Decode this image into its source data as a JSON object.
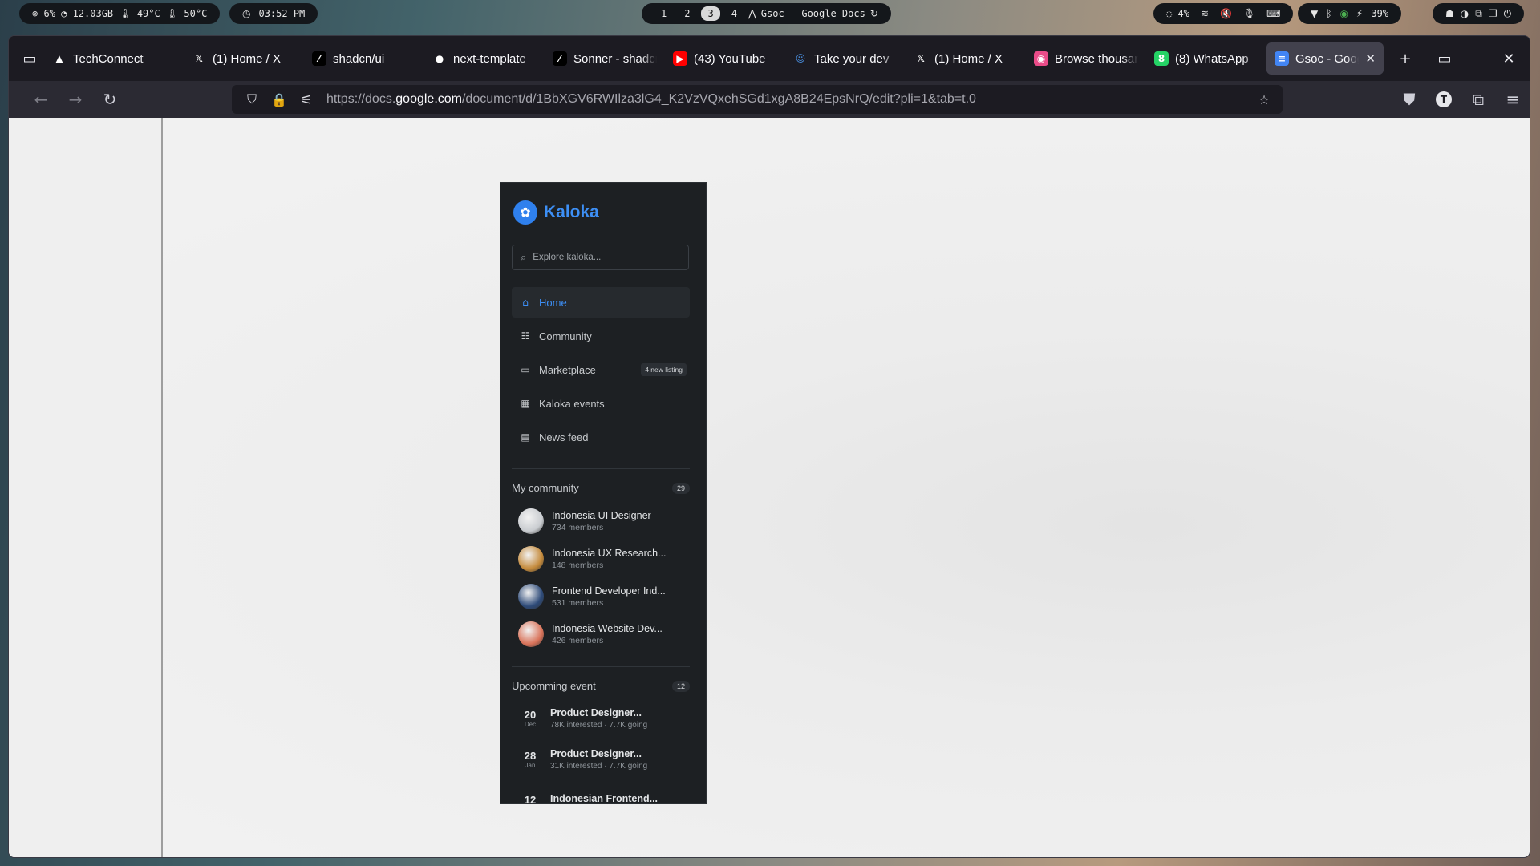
{
  "sysbar": {
    "stats": "⊚ 6%  ◔ 12.03GB  🌡 49°C  🌡 50°C",
    "clock": "03:52 PM",
    "workspaces": [
      "1",
      "2",
      "3",
      "4"
    ],
    "active_workspace": "3",
    "window_title": "Gsoc - Google Docs",
    "status_left": "◌ 4%",
    "battery": "39%"
  },
  "browser": {
    "tabs": [
      {
        "label": "TechConnect",
        "icon": "techconnect-icon",
        "fav": "▲",
        "fav_bg": "#1c1b22",
        "fav_fg": "#ffffff"
      },
      {
        "label": "(1) Home / X",
        "icon": "x-icon",
        "fav": "𝕏",
        "fav_bg": "#1c1b22",
        "fav_fg": "#ffffff"
      },
      {
        "label": "shadcn/ui",
        "icon": "shadcn-icon",
        "fav": "⁄",
        "fav_bg": "#000000",
        "fav_fg": "#ffffff"
      },
      {
        "label": "next-template",
        "icon": "github-icon",
        "fav": "●",
        "fav_bg": "#1c1b22",
        "fav_fg": "#ffffff"
      },
      {
        "label": "Sonner - shadcn",
        "icon": "shadcn-icon",
        "fav": "⁄",
        "fav_bg": "#000000",
        "fav_fg": "#ffffff"
      },
      {
        "label": "(43) YouTube",
        "icon": "youtube-icon",
        "fav": "▶",
        "fav_bg": "#ff0000",
        "fav_fg": "#ffffff"
      },
      {
        "label": "Take your dev",
        "icon": "devpost-icon",
        "fav": "☺",
        "fav_bg": "#1c1b22",
        "fav_fg": "#4a90e2"
      },
      {
        "label": "(1) Home / X",
        "icon": "x-icon",
        "fav": "𝕏",
        "fav_bg": "#1c1b22",
        "fav_fg": "#ffffff"
      },
      {
        "label": "Browse thousands",
        "icon": "dribbble-icon",
        "fav": "◉",
        "fav_bg": "#ea4c89",
        "fav_fg": "#ffffff"
      },
      {
        "label": "(8) WhatsApp",
        "icon": "whatsapp-icon",
        "fav": "8",
        "fav_bg": "#25d366",
        "fav_fg": "#ffffff"
      },
      {
        "label": "Gsoc - Google Docs",
        "icon": "google-docs-icon",
        "fav": "≡",
        "fav_bg": "#4285f4",
        "fav_fg": "#ffffff",
        "active": true
      }
    ],
    "url_prefix": "https://docs.",
    "url_host": "google.com",
    "url_path": "/document/d/1BbXGV6RWIlza3lG4_K2VzVQxehSGd1xgA8B24EpsNrQ/edit?pli=1&tab=t.0"
  },
  "kaloka": {
    "brand": "Kaloka",
    "search_placeholder": "Explore kaloka...",
    "menu": [
      {
        "label": "Home",
        "icon": "home-icon",
        "glyph": "⌂",
        "active": true
      },
      {
        "label": "Community",
        "icon": "community-icon",
        "glyph": "☷"
      },
      {
        "label": "Marketplace",
        "icon": "marketplace-icon",
        "glyph": "▭",
        "badge": "4 new listing"
      },
      {
        "label": "Kaloka events",
        "icon": "calendar-icon",
        "glyph": "▦"
      },
      {
        "label": "News feed",
        "icon": "newsfeed-icon",
        "glyph": "▤"
      }
    ],
    "my_community": {
      "title": "My community",
      "count": "29",
      "items": [
        {
          "name": "Indonesia UI Designer",
          "members": "734 members",
          "color": "#c9ccd0"
        },
        {
          "name": "Indonesia UX Research...",
          "members": "148 members",
          "color": "#c48a3b"
        },
        {
          "name": "Frontend Developer Ind...",
          "members": "531 members",
          "color": "#2d4a78"
        },
        {
          "name": "Indonesia Website Dev...",
          "members": "426 members",
          "color": "#d9735a"
        }
      ]
    },
    "upcoming_event": {
      "title": "Upcomming event",
      "count": "12",
      "items": [
        {
          "day": "20",
          "month": "Dec",
          "name": "Product Designer...",
          "meta": "78K interested · 7.7K going"
        },
        {
          "day": "28",
          "month": "Jan",
          "name": "Product Designer...",
          "meta": "31K interested · 7.7K going"
        },
        {
          "day": "12",
          "month": "",
          "name": "Indonesian Frontend...",
          "meta": ""
        }
      ]
    }
  }
}
